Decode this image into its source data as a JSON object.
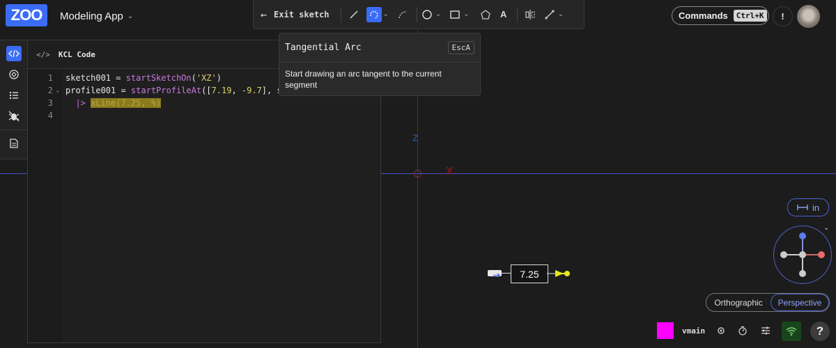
{
  "app": {
    "logo": "ZOO",
    "title": "Modeling App"
  },
  "toolbar": {
    "exit_label": "Exit sketch",
    "tools": [
      "line-tool",
      "tangential-arc-tool",
      "three-point-arc-tool",
      "circle-tool",
      "rectangle-tool",
      "polygon-tool",
      "text-tool",
      "mirror-tool",
      "constraint-tool"
    ],
    "active_tool": "tangential-arc-tool"
  },
  "commands": {
    "label": "Commands",
    "shortcut": "Ctrl+K"
  },
  "alert": {
    "label": "!"
  },
  "rail": {
    "items": [
      "code-icon",
      "parts-icon",
      "list-icon",
      "bug-icon",
      "document-icon"
    ],
    "active": "code-icon"
  },
  "panel": {
    "title": "KCL Code"
  },
  "code": {
    "lines": [
      {
        "num": "1",
        "tokens": [
          {
            "t": "sketch001 = ",
            "c": "c-id"
          },
          {
            "t": "startSketchOn",
            "c": "c-fn"
          },
          {
            "t": "(",
            "c": "c-id"
          },
          {
            "t": "'XZ'",
            "c": "c-str"
          },
          {
            "t": ")",
            "c": "c-id"
          }
        ]
      },
      {
        "num": "2",
        "tokens": [
          {
            "t": "profile001 = ",
            "c": "c-id"
          },
          {
            "t": "startProfileAt",
            "c": "c-fn"
          },
          {
            "t": "([",
            "c": "c-id"
          },
          {
            "t": "7.19",
            "c": "c-num"
          },
          {
            "t": ", ",
            "c": "c-id"
          },
          {
            "t": "-9.7",
            "c": "c-num"
          },
          {
            "t": "], s",
            "c": "c-id"
          }
        ]
      },
      {
        "num": "3",
        "tokens": [
          {
            "t": "  |> ",
            "c": "c-fn"
          },
          {
            "t": "xLine(7.25, %)",
            "c": "hl"
          }
        ]
      },
      {
        "num": "4",
        "tokens": []
      }
    ]
  },
  "tooltip": {
    "title": "Tangential Arc",
    "shortcut": "EscA",
    "body": "Start drawing an arc tangent to the current segment"
  },
  "viewport": {
    "dimension_value": "7.25",
    "axis_z": "Z",
    "axis_x": "X"
  },
  "units": {
    "label": "in"
  },
  "projection": {
    "options": [
      "Orthographic",
      "Perspective"
    ],
    "selected": "Perspective"
  },
  "status": {
    "branch": "vmain",
    "swatch_color": "#ff00ff",
    "help": "?"
  },
  "colors": {
    "accent": "#3b6cf6",
    "guide_h": "#4d52c9",
    "guide_v": "#6b2a2a",
    "highlight": "#8a7b1e"
  }
}
